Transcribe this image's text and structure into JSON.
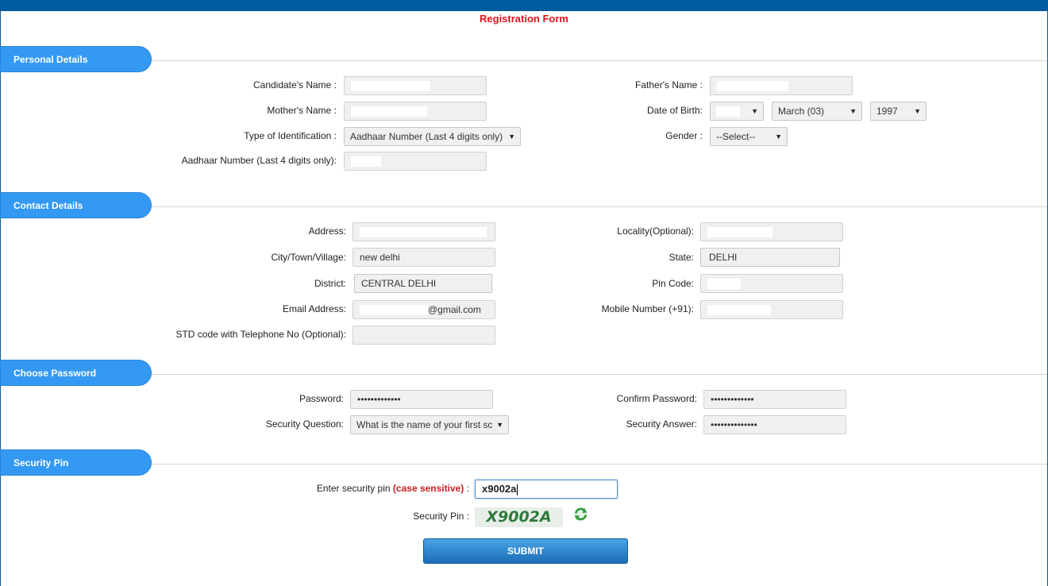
{
  "form": {
    "title": "Registration Form"
  },
  "sections": {
    "personal": "Personal Details",
    "contact": "Contact Details",
    "password": "Choose Password",
    "pin": "Security Pin"
  },
  "personal": {
    "candidate_name_label": "Candidate's Name :",
    "father_name_label": "Father's Name :",
    "mother_name_label": "Mother's Name :",
    "dob_label": "Date of Birth:",
    "dob_month": "March (03)",
    "dob_year": "1997",
    "id_type_label": "Type of Identification :",
    "id_type_value": "Aadhaar Number (Last 4 digits only)",
    "gender_label": "Gender :",
    "gender_value": "--Select--",
    "aadhaar_label": "Aadhaar Number (Last 4 digits only):"
  },
  "contact": {
    "address_label": "Address:",
    "locality_label": "Locality(Optional):",
    "city_label": "City/Town/Village:",
    "city_value": "new delhi",
    "state_label": "State:",
    "state_value": "DELHI",
    "district_label": "District:",
    "district_value": "CENTRAL DELHI",
    "pincode_label": "Pin Code:",
    "email_label": "Email Address:",
    "email_value": "@gmail.com",
    "mobile_label": "Mobile Number (+91):",
    "std_label": "STD code with Telephone No (Optional):"
  },
  "password": {
    "password_label": "Password:",
    "password_value": "•••••••••••••",
    "confirm_label": "Confirm Password:",
    "confirm_value": "•••••••••••••",
    "question_label": "Security Question:",
    "question_value": "What is the name of your first sc",
    "answer_label": "Security Answer:",
    "answer_value": "••••••••••••••"
  },
  "pin": {
    "enter_label": "Enter security pin",
    "case_note": "(case sensitive)",
    "colon": ":",
    "input_value": "x9002a",
    "display_label": "Security Pin :",
    "captcha_text": "X9002A",
    "refresh_icon": "refresh-icon"
  },
  "submit_label": "SUBMIT",
  "colors": {
    "topbar": "#005a9e",
    "section_tab": "#3399f3",
    "title": "#e0141e",
    "submit": "#1a6eb5"
  }
}
